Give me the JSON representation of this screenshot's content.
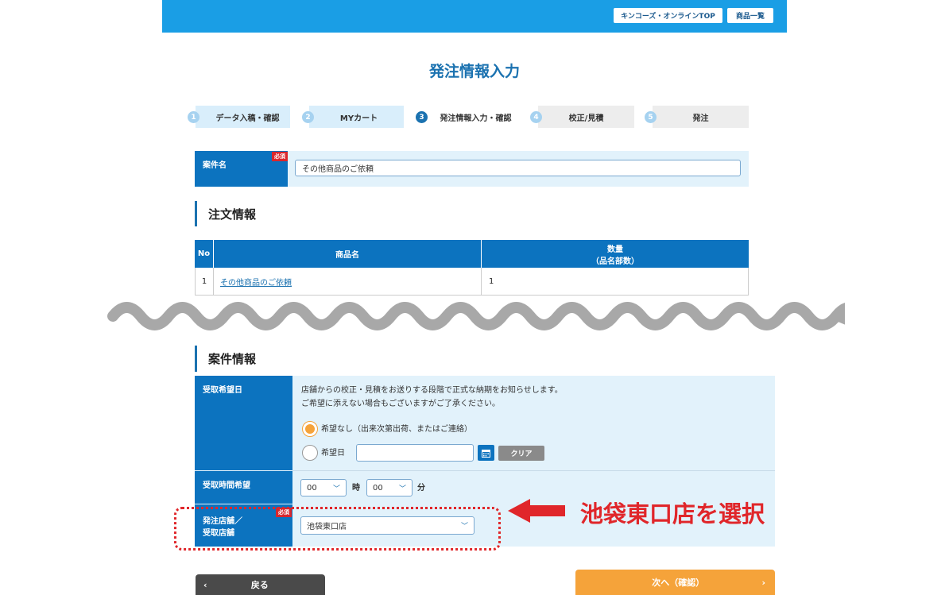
{
  "header": {
    "top_link": "キンコーズ・オンラインTOP",
    "products_link": "商品一覧",
    "colors": {
      "brand": "#1a9ee5",
      "label": "#0c73bf",
      "accent": "#f5a33a",
      "alert": "#e0262a"
    }
  },
  "page_title": "発注情報入力",
  "steps": [
    {
      "num": "1",
      "label": "データ入稿・確認"
    },
    {
      "num": "2",
      "label": "MYカート"
    },
    {
      "num": "3",
      "label": "発注情報入力・確認"
    },
    {
      "num": "4",
      "label": "校正/見積"
    },
    {
      "num": "5",
      "label": "発注"
    }
  ],
  "project": {
    "label": "案件名",
    "required": "必須",
    "value": "その他商品のご依頼"
  },
  "order_section": {
    "title": "注文情報",
    "columns": [
      "No",
      "商品名",
      "数量",
      "（品名部数）"
    ],
    "rows": [
      {
        "no": "1",
        "product": "その他商品のご依頼",
        "qty": "1"
      }
    ]
  },
  "case_section": {
    "title": "案件情報",
    "pickup_date": {
      "label": "受取希望日",
      "note_line1": "店舗からの校正・見積をお送りする段階で正式な納期をお知らせします。",
      "note_line2": "ご希望に添えない場合もございますがご了承ください。",
      "option_none": "希望なし（出来次第出荷、またはご連絡）",
      "option_date": "希望日",
      "date_value": "",
      "clear_label": "クリア"
    },
    "pickup_time": {
      "label": "受取時間希望",
      "hour": "00",
      "hour_unit": "時",
      "minute": "00",
      "minute_unit": "分"
    },
    "store": {
      "label_line1": "発注店舗／",
      "label_line2": "受取店舗",
      "required": "必須",
      "value": "池袋東口店"
    }
  },
  "annotation": "池袋東口店を選択",
  "buttons": {
    "back": "戻る",
    "next": "次へ（確認）"
  }
}
